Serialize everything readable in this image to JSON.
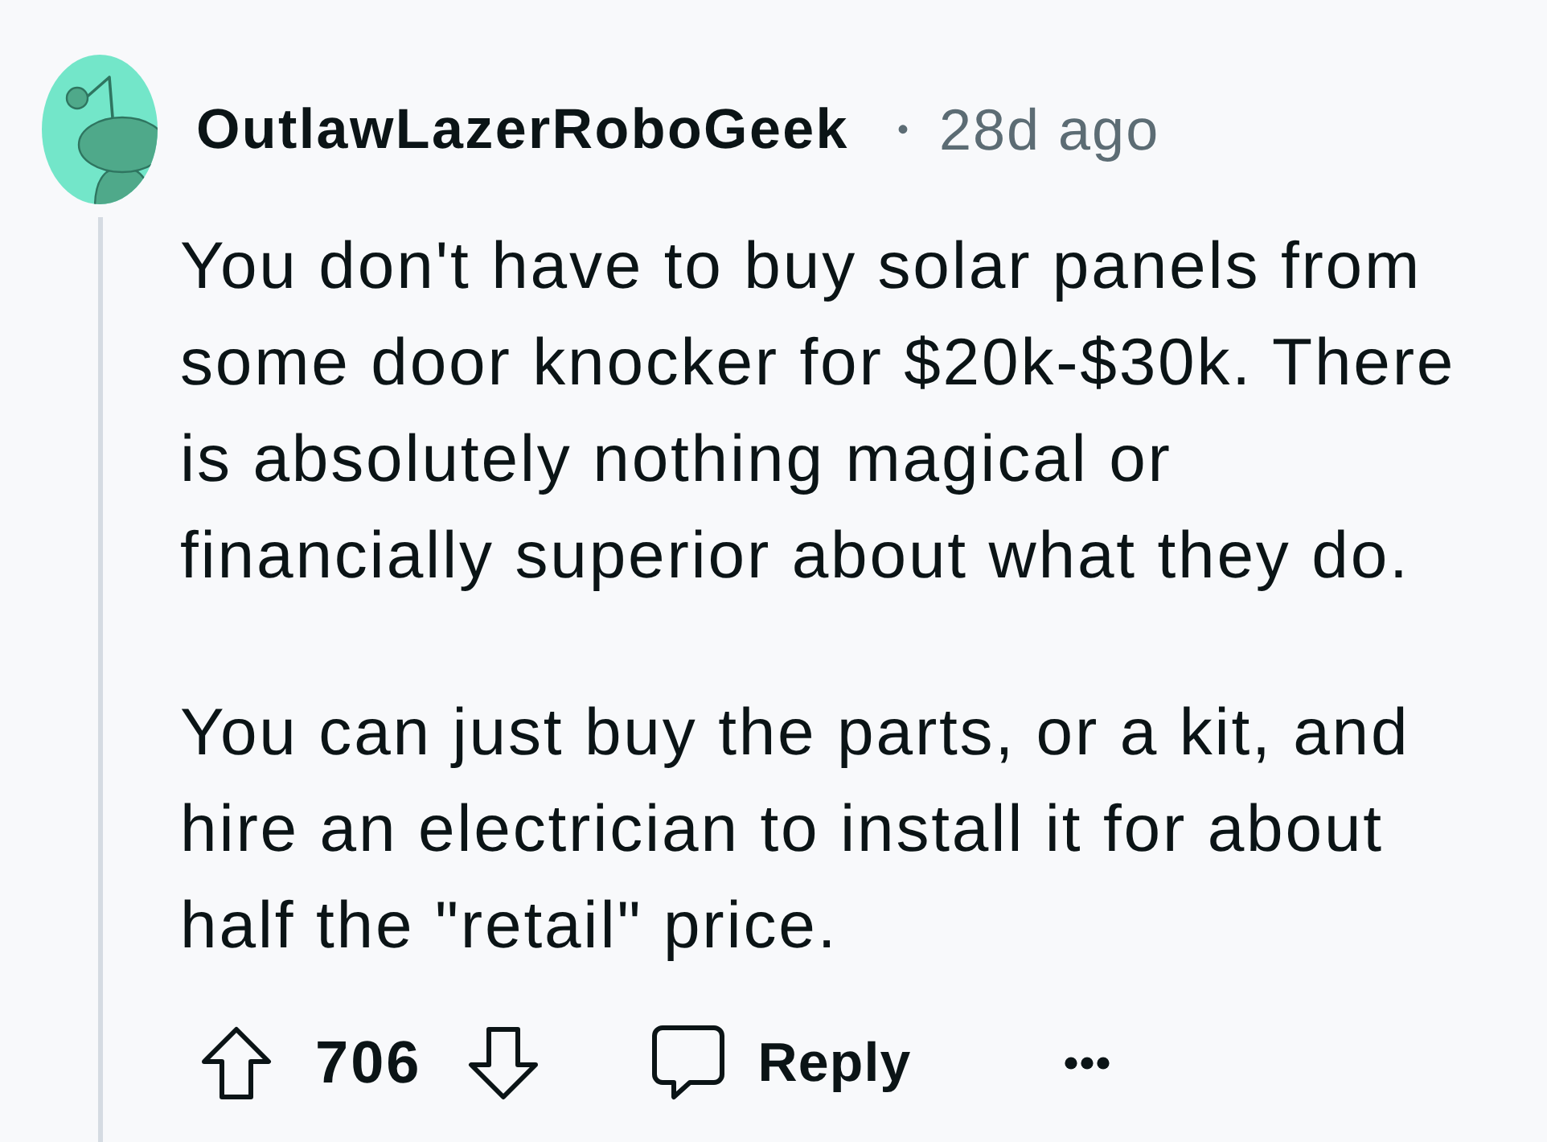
{
  "comment": {
    "author": "OutlawLazerRoboGeek",
    "separator": "•",
    "age": "28d ago",
    "paragraphs": [
      {
        "lines": [
          "You don't have to buy solar panels from",
          "some door knocker for $20k-$30k. There",
          "is absolutely nothing magical or",
          "financially superior about what they do."
        ]
      },
      {
        "lines": [
          "You can just buy the parts, or a kit, and",
          "hire an electrician to install it for about",
          "half the \"retail\" price."
        ]
      }
    ],
    "actions": {
      "score": "706",
      "reply": "Reply"
    }
  }
}
